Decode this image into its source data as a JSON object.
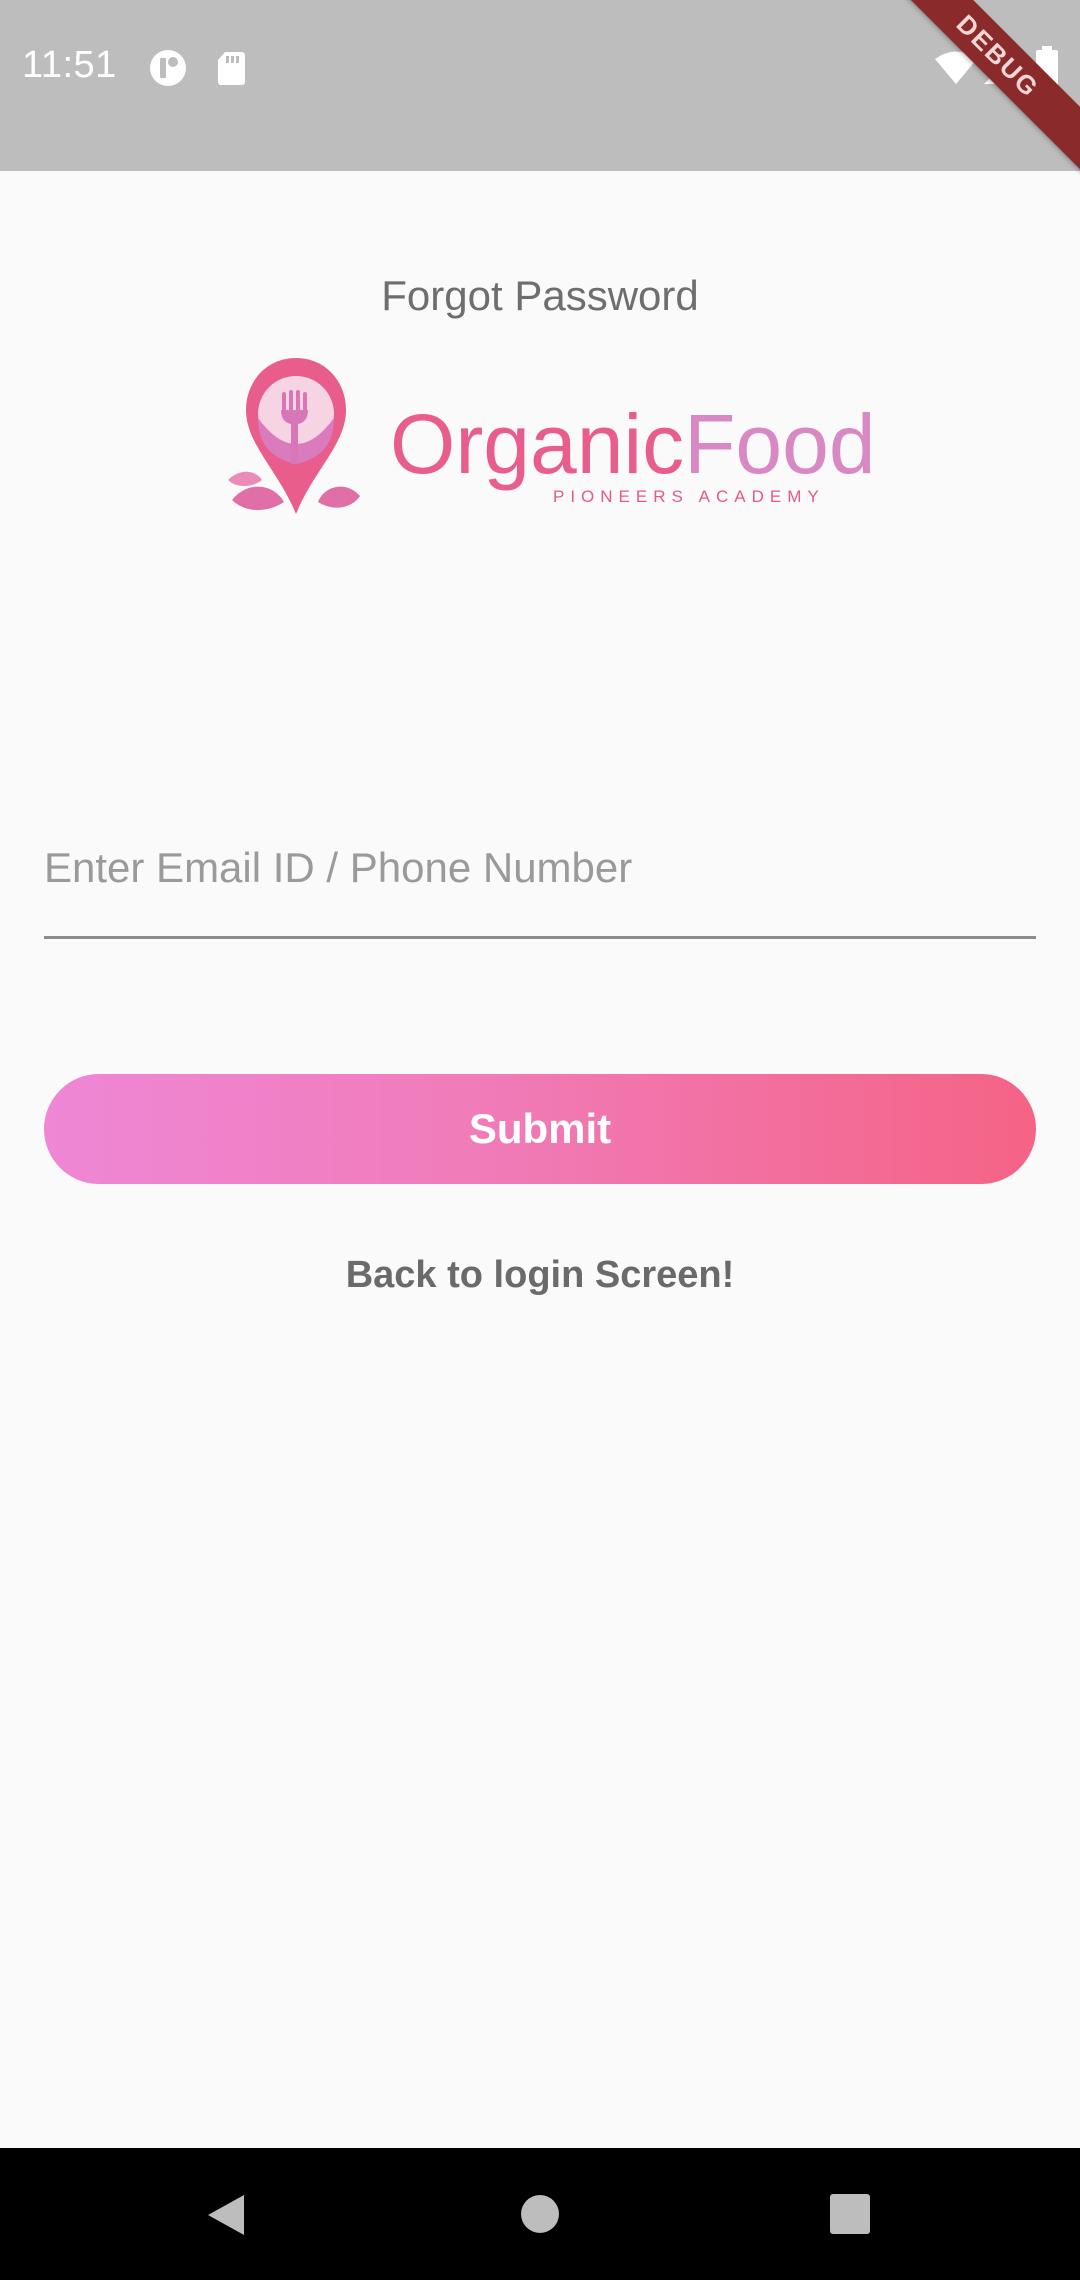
{
  "status_bar": {
    "time": "11:51",
    "left_icons": [
      "data-saver-icon",
      "sd-card-icon"
    ],
    "right_icons": [
      "wifi-icon",
      "signal-icon",
      "battery-icon"
    ],
    "debug_banner": "DEBUG"
  },
  "page": {
    "title": "Forgot Password"
  },
  "logo": {
    "word_primary": "Organic",
    "word_secondary": "Food",
    "tagline": "PIONEERS ACADEMY",
    "icon": "fork-pin-icon"
  },
  "form": {
    "email": {
      "value": "",
      "placeholder": "Enter Email ID / Phone Number"
    },
    "submit_label": "Submit",
    "back_link_label": "Back to login Screen!"
  },
  "nav_bar": {
    "buttons": [
      "back-icon",
      "home-icon",
      "recents-icon"
    ]
  },
  "colors": {
    "primary_pink": "#f56386",
    "gradient_start": "#ef87d6",
    "logo_pink": "#e85d8e",
    "logo_light_pink": "#d889c4",
    "status_bar": "#bdbdbd",
    "background": "#fafafa"
  }
}
